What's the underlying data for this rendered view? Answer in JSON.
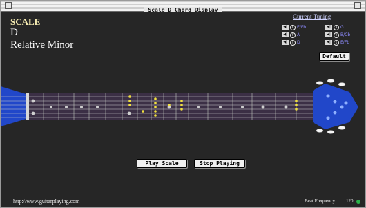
{
  "window": {
    "title": "Scale D Chord Display"
  },
  "scale": {
    "heading": "SCALE",
    "key": "D",
    "mode": "Relative Minor"
  },
  "tuning": {
    "heading": "Current Tuning",
    "strings": [
      {
        "num": "6",
        "note": "E/Fb",
        "speaker": "◀|"
      },
      {
        "num": "5",
        "note": "A",
        "speaker": "◀|"
      },
      {
        "num": "4",
        "note": "D",
        "speaker": "◀|"
      },
      {
        "num": "3",
        "note": "G",
        "speaker": "◀|"
      },
      {
        "num": "2",
        "note": "B/Cb",
        "speaker": "◀|"
      },
      {
        "num": "1",
        "note": "E/Fb",
        "speaker": "◀|"
      }
    ]
  },
  "buttons": {
    "default": "Default",
    "play": "Play Scale",
    "stop": "Stop Playing"
  },
  "footer": {
    "url": "http://www.guitarplaying.com",
    "beat_label": "Beat Frequency",
    "beat_value": "120"
  },
  "colors": {
    "background": "#262626",
    "fretboard": "#3b2f45",
    "headstock": "#2147c9",
    "highlight": "#f0e040",
    "heading": "#f3e9b0",
    "tuning_heading": "#cfd3ff",
    "note_text": "#8e8cff",
    "beat_indicator": "#2bb34a"
  }
}
